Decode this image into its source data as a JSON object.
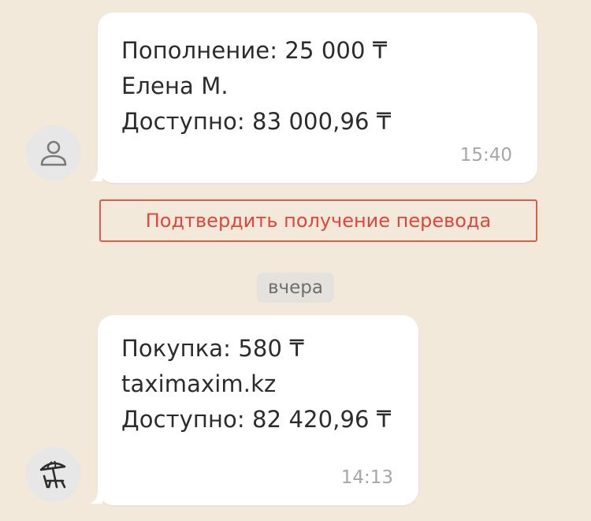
{
  "messages": [
    {
      "lines": [
        "Пополнение: 25 000 ₸",
        "Елена М.",
        "Доступно: 83 000,96 ₸"
      ],
      "time": "15:40",
      "avatar_icon": "person-icon"
    },
    {
      "lines": [
        "Покупка: 580 ₸",
        "taximaxim.kz",
        "Доступно: 82 420,96 ₸"
      ],
      "time": "14:13",
      "avatar_icon": "beach-umbrella-icon"
    }
  ],
  "confirm_button": {
    "label": "Подтвердить получение перевода"
  },
  "date_separator": "вчера",
  "colors": {
    "background": "#f2e9db",
    "bubble": "#ffffff",
    "accent_red": "#e0463a",
    "time_text": "#a7a7a7"
  }
}
